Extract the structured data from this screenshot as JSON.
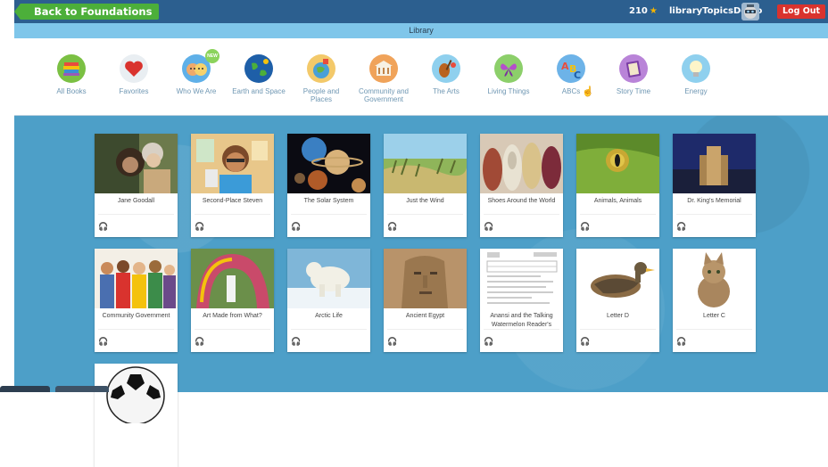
{
  "header": {
    "back_label": "Back to Foundations",
    "stars": "210",
    "username": "libraryTopicsDemo",
    "logout_label": "Log Out"
  },
  "library_bar": {
    "title": "Library"
  },
  "categories": [
    {
      "label": "All Books",
      "icon": "all-books-icon"
    },
    {
      "label": "Favorites",
      "icon": "heart-icon"
    },
    {
      "label": "Who We Are",
      "icon": "face-icon",
      "badge": "NEW"
    },
    {
      "label": "Earth and Space",
      "icon": "earth-icon"
    },
    {
      "label": "People and Places",
      "icon": "people-places-icon"
    },
    {
      "label": "Community and Government",
      "icon": "building-icon"
    },
    {
      "label": "The Arts",
      "icon": "violin-icon"
    },
    {
      "label": "Living Things",
      "icon": "butterfly-icon"
    },
    {
      "label": "ABCs",
      "icon": "abc-icon"
    },
    {
      "label": "Story Time",
      "icon": "book-icon"
    },
    {
      "label": "Energy",
      "icon": "lightbulb-icon"
    }
  ],
  "books": [
    {
      "title": "Jane Goodall"
    },
    {
      "title": "Second-Place Steven"
    },
    {
      "title": "The Solar System"
    },
    {
      "title": "Just the Wind"
    },
    {
      "title": "Shoes Around the World"
    },
    {
      "title": "Animals, Animals"
    },
    {
      "title": "Dr. King's Memorial"
    },
    {
      "title": "Community Government"
    },
    {
      "title": "Art Made from What?"
    },
    {
      "title": "Arctic Life"
    },
    {
      "title": "Ancient Egypt"
    },
    {
      "title": "Anansi and the Talking Watermelon Reader's"
    },
    {
      "title": "Letter D"
    },
    {
      "title": "Letter C"
    },
    {
      "title": ""
    }
  ],
  "colors": {
    "header_bg": "#2c5f8f",
    "back_button": "#4caf3a",
    "logout_button": "#d9332e",
    "library_bar": "#7fc6ea",
    "content_bg": "#4d9fc8",
    "star": "#f4b400"
  }
}
